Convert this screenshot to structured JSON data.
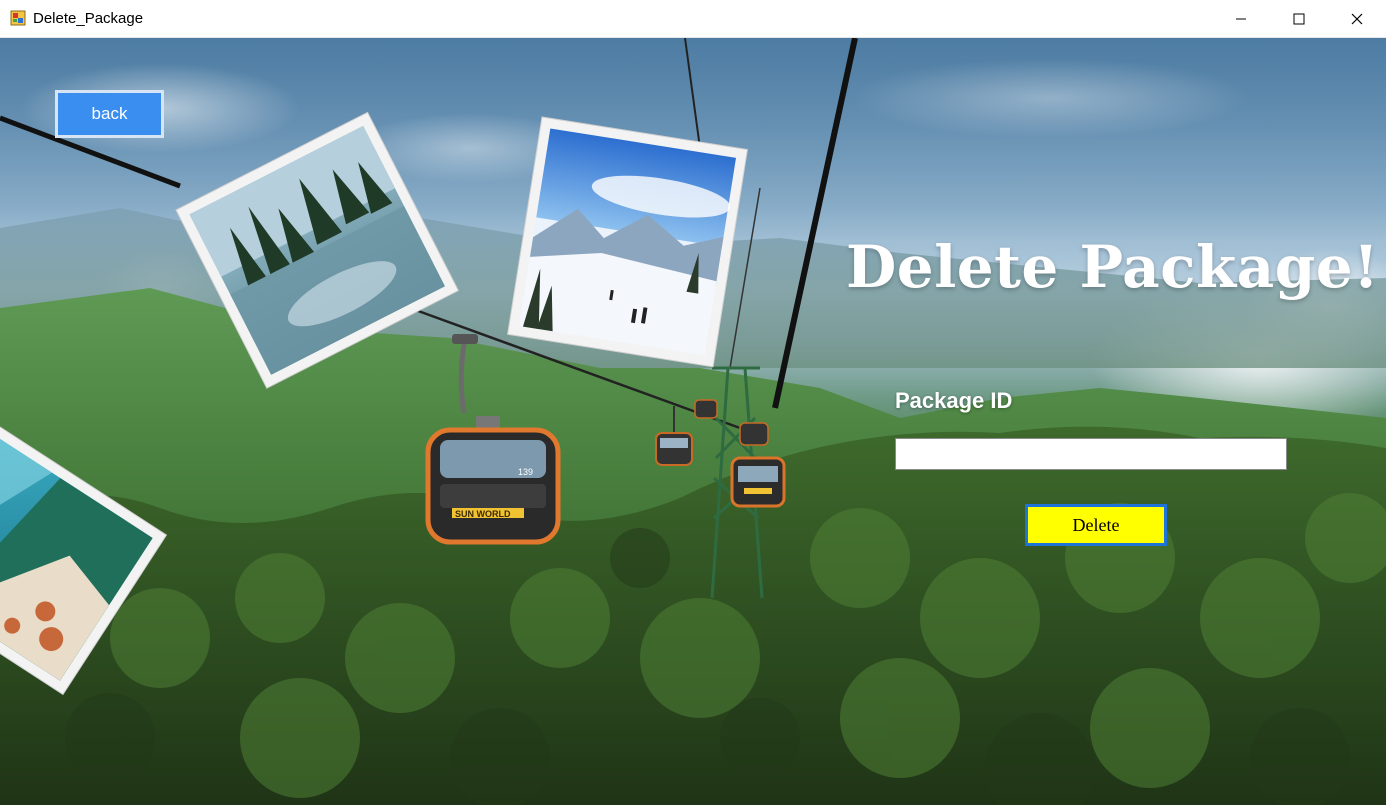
{
  "window": {
    "title": "Delete_Package",
    "icons": [
      "app-icon",
      "minimize-icon",
      "maximize-icon",
      "close-icon"
    ]
  },
  "nav": {
    "back_label": "back"
  },
  "form": {
    "heading": "Delete Package!",
    "package_id_label": "Package ID",
    "package_id_value": "",
    "delete_label": "Delete"
  },
  "cable_car": {
    "number": "139",
    "brand": "SUN WORLD"
  },
  "colors": {
    "back_button": "#3a8ef0",
    "delete_button": "#ffff00",
    "delete_border": "#1e73d8",
    "heading_text": "#ffffff"
  }
}
